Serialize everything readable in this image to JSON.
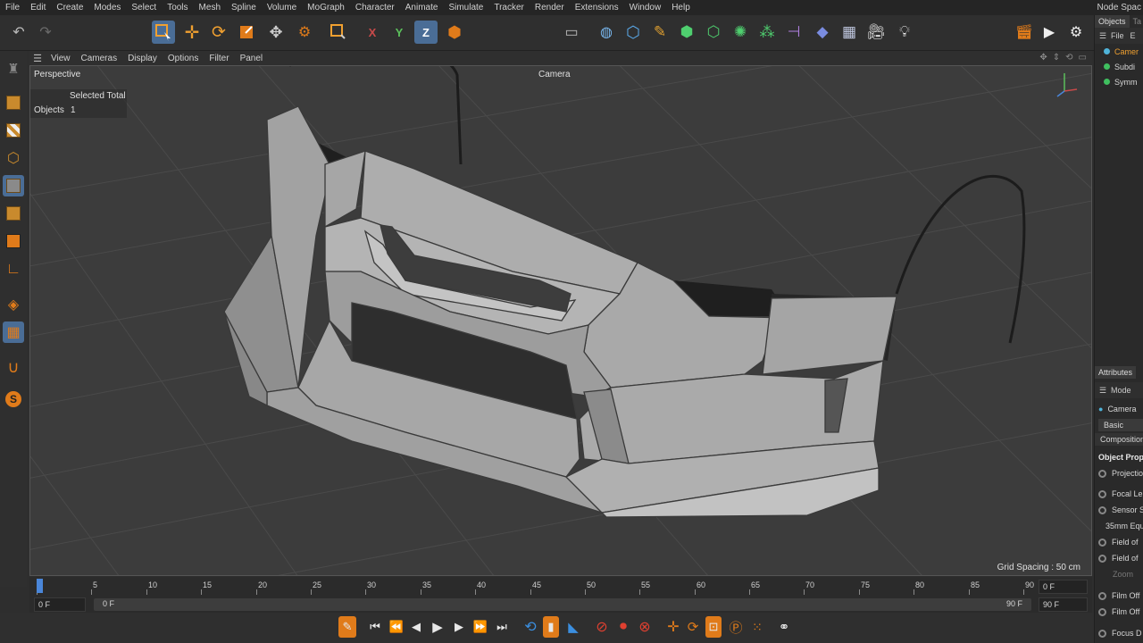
{
  "menu": [
    "File",
    "Edit",
    "Create",
    "Modes",
    "Select",
    "Tools",
    "Mesh",
    "Spline",
    "Volume",
    "MoGraph",
    "Character",
    "Animate",
    "Simulate",
    "Tracker",
    "Render",
    "Extensions",
    "Window",
    "Help"
  ],
  "menu_right": "Node Spac",
  "viewport": {
    "menu": [
      "View",
      "Cameras",
      "Display",
      "Options",
      "Filter",
      "Panel"
    ],
    "name": "Perspective",
    "camera_label": "Camera",
    "stats_header": "Selected Total",
    "stats_label": "Objects",
    "stats_value": "1",
    "grid_spacing": "Grid Spacing : 50 cm"
  },
  "toolbar": {
    "axis_x": "X",
    "axis_y": "Y",
    "axis_z": "Z"
  },
  "objects_panel": {
    "tabs": [
      "Objects",
      "Ta"
    ],
    "sub": [
      "File",
      "E"
    ],
    "items": [
      {
        "label": "Camer",
        "color": "#4fb3d9",
        "selected": true
      },
      {
        "label": "Subdi",
        "color": "#3fbf5f",
        "selected": false
      },
      {
        "label": "Symm",
        "color": "#3fbf5f",
        "selected": false
      }
    ]
  },
  "attributes_panel": {
    "tab": "Attributes",
    "mode": "Mode",
    "object": "Camera",
    "pills": [
      "Basic",
      "Composition"
    ],
    "section": "Object Prop",
    "rows": [
      "Projectio",
      "Focal Le",
      "Sensor S",
      "35mm Equ",
      "Field of",
      "Field of",
      "Zoom",
      "Film Off",
      "Film Off",
      "Focus D"
    ]
  },
  "timeline": {
    "ticks": [
      "0",
      "5",
      "10",
      "15",
      "20",
      "25",
      "30",
      "35",
      "40",
      "45",
      "50",
      "55",
      "60",
      "65",
      "70",
      "75",
      "80",
      "85",
      "90"
    ],
    "current_frame": "0 F",
    "end_frame": "90 F",
    "range_start": "0 F",
    "range_start_inner": "0 F",
    "range_end_inner": "90 F",
    "range_end": "90 F"
  },
  "colors": {
    "accent_blue": "#4a6d96",
    "orange": "#e07b1a",
    "record_red": "#e04030",
    "viewport_bg": "#3c3c3c"
  }
}
